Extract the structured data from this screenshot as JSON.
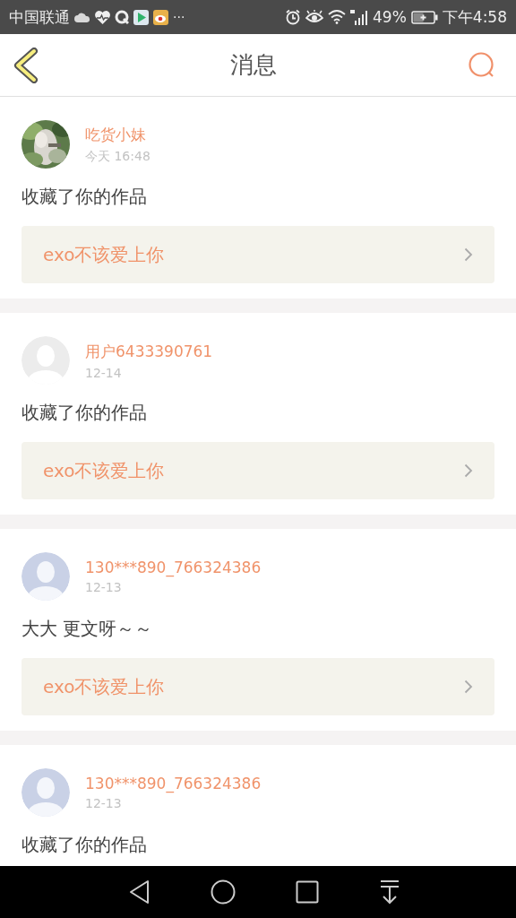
{
  "status_bar": {
    "carrier": "中国联通",
    "more": "···",
    "battery": "49%",
    "time": "下午4:58"
  },
  "header": {
    "title": "消息"
  },
  "messages": [
    {
      "name": "吃货小妹",
      "time": "今天 16:48",
      "text": "收藏了你的作品",
      "work": "exo不该爱上你"
    },
    {
      "avatar": {
        "kind": "grey"
      },
      "name": "用户6433390761",
      "time": "12-14",
      "text": "收藏了你的作品",
      "work": "exo不该爱上你"
    },
    {
      "avatar": {
        "kind": "blue"
      },
      "name": "130***890_766324386",
      "time": "12-13",
      "text": "大大 更文呀～～",
      "work": "exo不该爱上你"
    },
    {
      "avatar": {
        "kind": "blue"
      },
      "name": "130***890_766324386",
      "time": "12-13",
      "text": "收藏了你的作品"
    }
  ]
}
